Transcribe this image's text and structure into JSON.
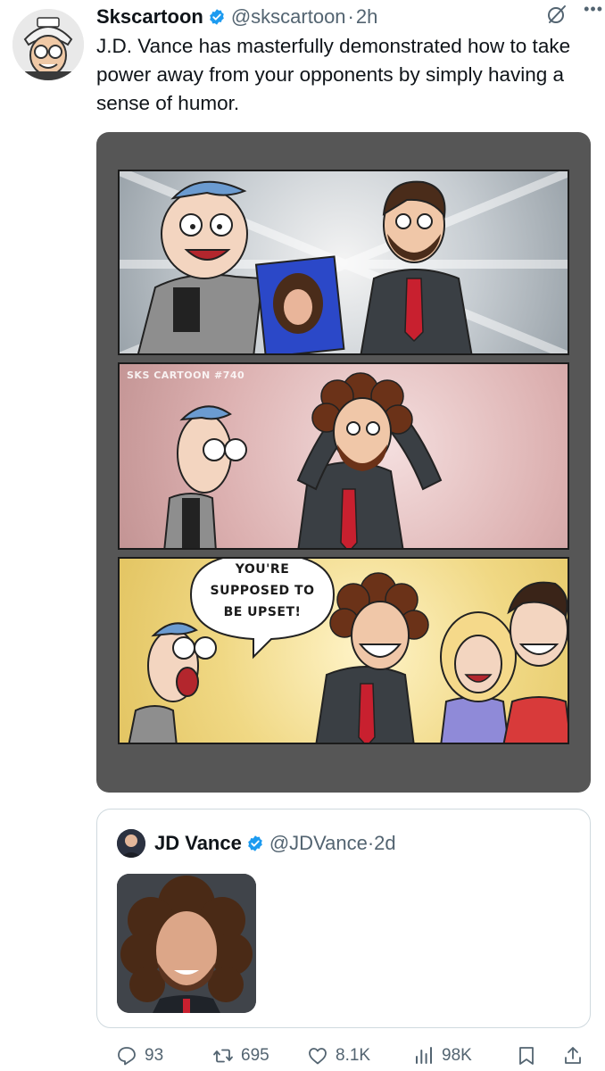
{
  "tweet": {
    "author": {
      "name": "Skscartoon",
      "handle": "@skscartoon",
      "time": "2h",
      "verified": true,
      "avatar_icon": "cartoon-avatar"
    },
    "text": "J.D. Vance has masterfully demonstrated how to take power away from your opponents by simply having a sense of humor.",
    "header_icons": [
      "grok-icon",
      "more-icon"
    ],
    "media": {
      "type": "comic",
      "panel_count": 3,
      "watermark": "SKS CARTOON #740",
      "speech_bubble": [
        "YOU'RE",
        "SUPPOSED TO",
        "BE UPSET!"
      ]
    }
  },
  "quote": {
    "author": {
      "name": "JD Vance",
      "handle": "@JDVance",
      "time": "2d",
      "verified": true
    },
    "media": {
      "type": "photo"
    }
  },
  "actions": {
    "replies": "93",
    "reposts": "695",
    "likes": "8.1K",
    "views": "98K",
    "bookmark_icon": "bookmark-icon",
    "share_icon": "share-icon"
  },
  "colors": {
    "text": "#0f1419",
    "secondary": "#536471",
    "verified": "#1d9bf0",
    "border": "#cfd9de",
    "comic_frame": "#565656",
    "tie": "#c8202f"
  }
}
